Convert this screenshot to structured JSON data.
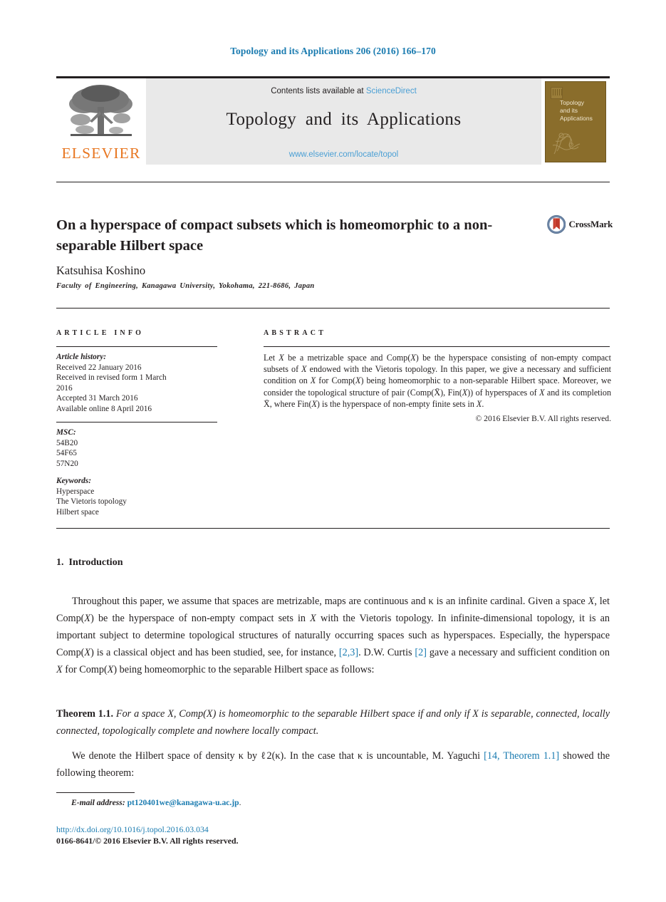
{
  "running_head": "Topology and its Applications 206 (2016) 166–170",
  "masthead": {
    "publisher_logo_name": "elsevier-tree-logo",
    "publisher_wordmark": "ELSEVIER",
    "contents_prefix": "Contents lists available at ",
    "contents_link": "ScienceDirect",
    "journal_name": "Topology and its Applications",
    "journal_url": "www.elsevier.com/locate/topol",
    "cover_title_line1": "Topology",
    "cover_title_line2": "and its",
    "cover_title_line3": "Applications"
  },
  "article": {
    "title": "On a hyperspace of compact subsets which is homeomorphic to a non-separable Hilbert space",
    "crossmark_label": "CrossMark",
    "author": "Katsuhisa Koshino",
    "affiliation": "Faculty of Engineering, Kanagawa University, Yokohama, 221-8686, Japan"
  },
  "info": {
    "section_label": "ARTICLE INFO",
    "history_heading": "Article history:",
    "history": [
      "Received 22 January 2016",
      "Received in revised form 1 March",
      "2016",
      "Accepted 31 March 2016",
      "Available online 8 April 2016"
    ],
    "msc_heading": "MSC:",
    "msc": [
      "54B20",
      "54F65",
      "57N20"
    ],
    "keywords_heading": "Keywords:",
    "keywords": [
      "Hyperspace",
      "The Vietoris topology",
      "Hilbert space"
    ]
  },
  "abstract": {
    "section_label": "ABSTRACT",
    "text": "Let X be a metrizable space and Comp(X) be the hyperspace consisting of non-empty compact subsets of X endowed with the Vietoris topology. In this paper, we give a necessary and sufficient condition on X for Comp(X) being homeomorphic to a non-separable Hilbert space. Moreover, we consider the topological structure of pair (Comp(X̄), Fin(X)) of hyperspaces of X and its completion X̄, where Fin(X) is the hyperspace of non-empty finite sets in X.",
    "copyright": "© 2016 Elsevier B.V. All rights reserved."
  },
  "body": {
    "section_number": "1.",
    "section_title": "Introduction",
    "paragraph1": "Throughout this paper, we assume that spaces are metrizable, maps are continuous and κ is an infinite cardinal. Given a space X, let Comp(X) be the hyperspace of non-empty compact sets in X with the Vietoris topology. In infinite-dimensional topology, it is an important subject to determine topological structures of naturally occurring spaces such as hyperspaces. Especially, the hyperspace Comp(X) is a classical object and has been studied, see, for instance, [2,3]. D.W. Curtis [2] gave a necessary and sufficient condition on X for Comp(X) being homeomorphic to the separable Hilbert space as follows:",
    "citation_23": "[2,3]",
    "citation_2": "[2]",
    "theorem_label": "Theorem 1.1.",
    "theorem_text": "For a space X, Comp(X) is homeomorphic to the separable Hilbert space if and only if X is separable, connected, locally connected, topologically complete and nowhere locally compact.",
    "paragraph2": "We denote the Hilbert space of density κ by ℓ2(κ). In the case that κ is uncountable, M. Yaguchi [14, Theorem 1.1] showed the following theorem:",
    "citation_14": "[14, Theorem 1.1]"
  },
  "footer": {
    "email_label": "E-mail address:",
    "email": "pt120401we@kanagawa-u.ac.jp",
    "email_suffix": ".",
    "doi": "http://dx.doi.org/10.1016/j.topol.2016.03.034",
    "issn_line": "0166-8641/© 2016 Elsevier B.V. All rights reserved."
  },
  "colors": {
    "link_blue": "#1a7bb0",
    "light_link_blue": "#4a9fd4",
    "elsevier_orange": "#e87722",
    "masthead_grey": "#e9e9e9",
    "cover_brown": "#8a6d2b",
    "text_black": "#231f20"
  }
}
